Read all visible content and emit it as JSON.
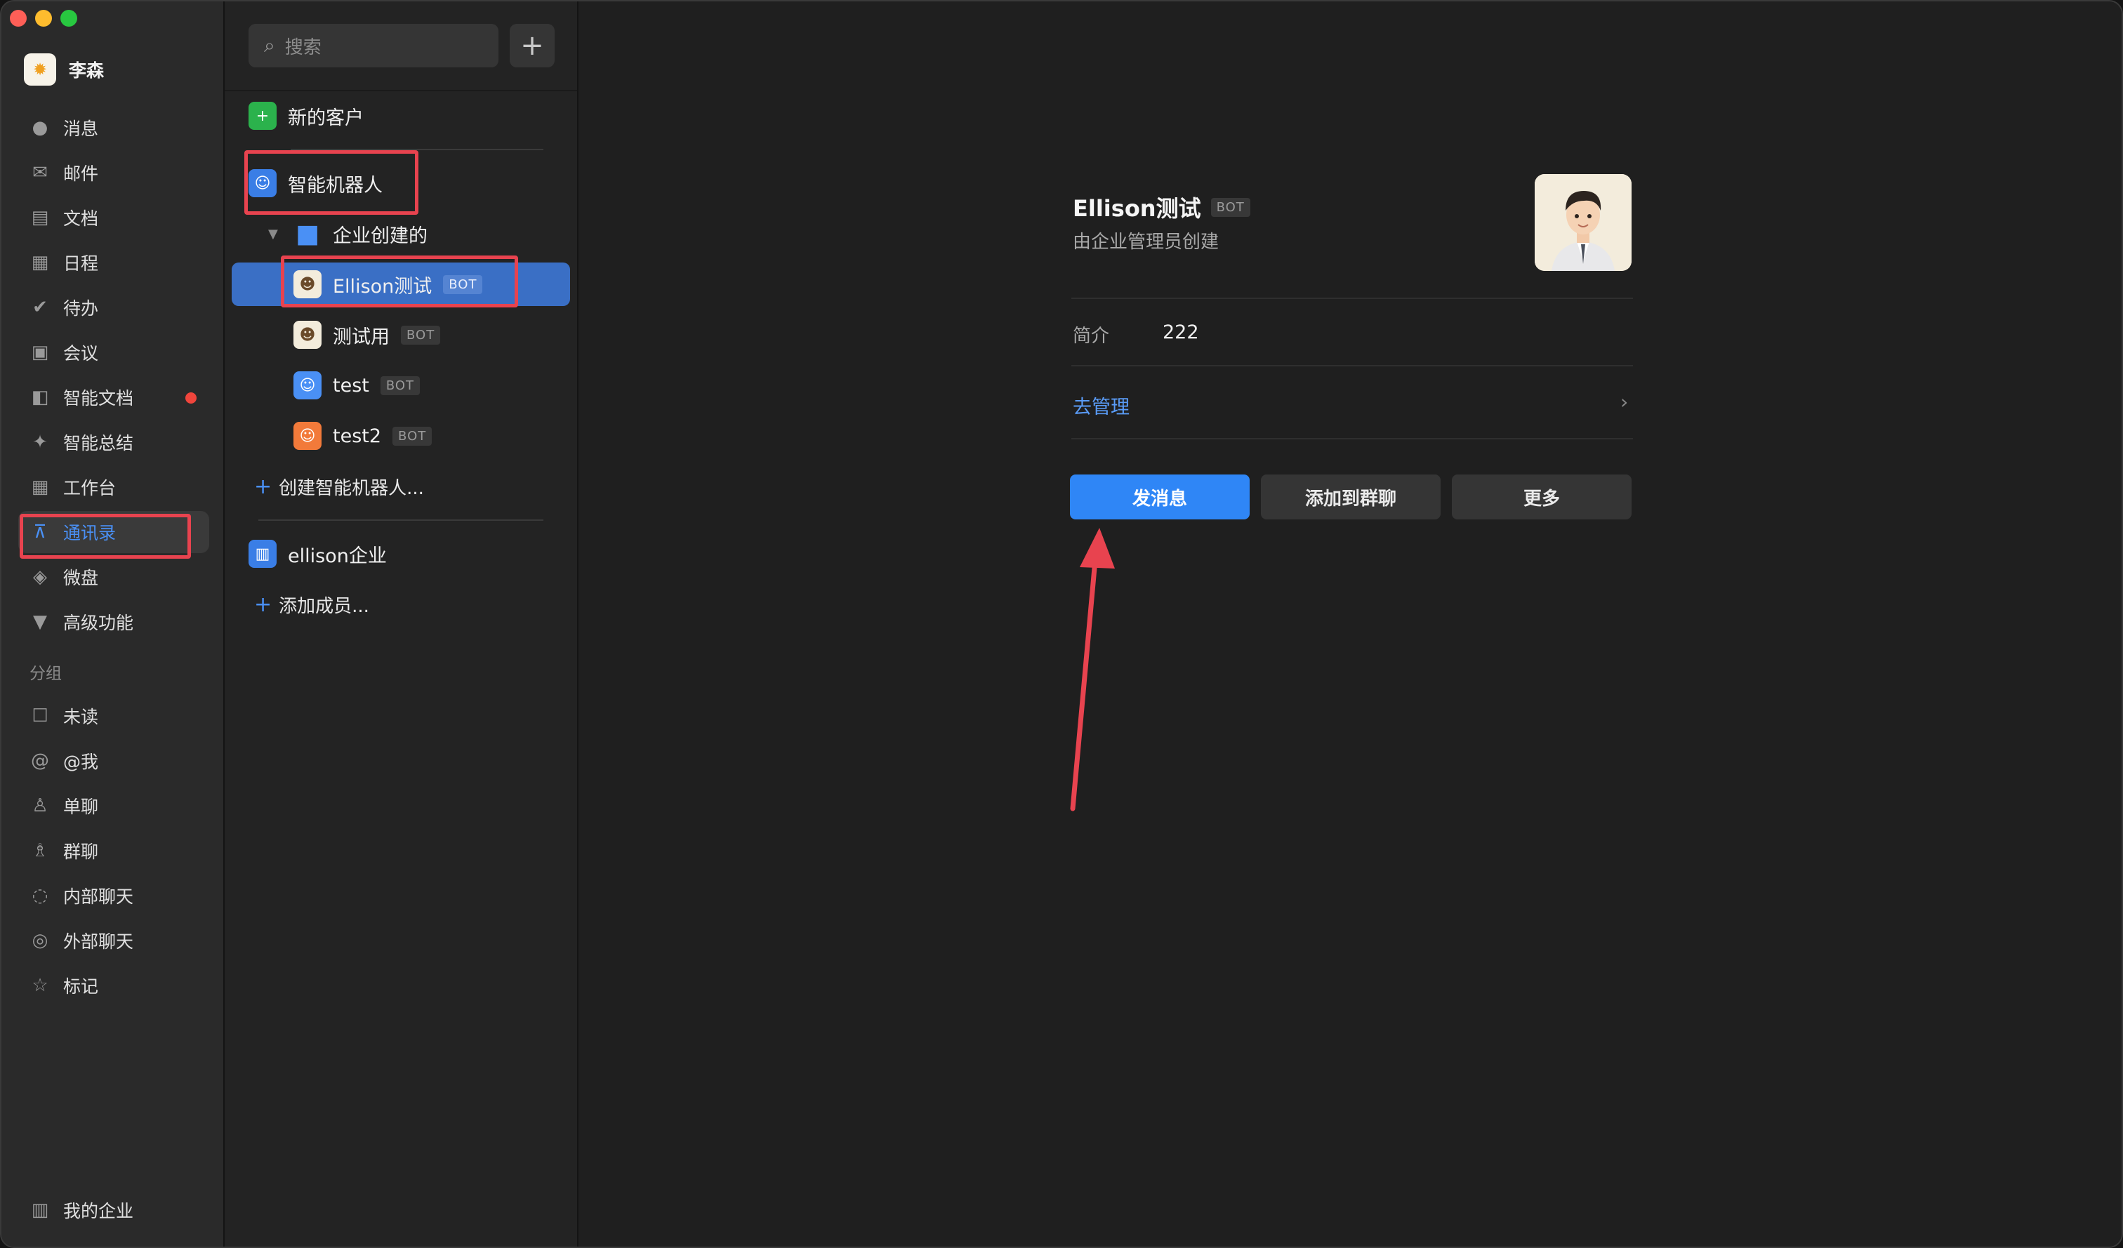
{
  "user": {
    "name": "李森"
  },
  "nav": {
    "items": [
      {
        "label": "消息",
        "icon": "chat-bubble-icon"
      },
      {
        "label": "邮件",
        "icon": "mail-icon"
      },
      {
        "label": "文档",
        "icon": "document-icon"
      },
      {
        "label": "日程",
        "icon": "calendar-icon"
      },
      {
        "label": "待办",
        "icon": "check-circle-icon"
      },
      {
        "label": "会议",
        "icon": "meeting-icon"
      },
      {
        "label": "智能文档",
        "icon": "smart-doc-icon"
      },
      {
        "label": "智能总结",
        "icon": "sparkle-icon"
      },
      {
        "label": "工作台",
        "icon": "grid-icon"
      },
      {
        "label": "通讯录",
        "icon": "org-chart-icon"
      },
      {
        "label": "微盘",
        "icon": "drive-icon"
      },
      {
        "label": "高级功能",
        "icon": "premium-icon"
      }
    ],
    "group_title": "分组",
    "groups": [
      {
        "label": "未读",
        "icon": "unread-icon"
      },
      {
        "label": "@我",
        "icon": "at-icon"
      },
      {
        "label": "单聊",
        "icon": "person-icon"
      },
      {
        "label": "群聊",
        "icon": "people-icon"
      },
      {
        "label": "内部聊天",
        "icon": "internal-chat-icon"
      },
      {
        "label": "外部聊天",
        "icon": "external-chat-icon"
      },
      {
        "label": "标记",
        "icon": "star-icon"
      }
    ],
    "footer": "我的企业"
  },
  "contacts": {
    "search_placeholder": "搜索",
    "new_customer": "新的客户",
    "robots_section": "智能机器人",
    "folder": "企业创建的",
    "bots": [
      {
        "name": "Ellison测试",
        "badge": "BOT"
      },
      {
        "name": "测试用",
        "badge": "BOT"
      },
      {
        "name": "test",
        "badge": "BOT"
      },
      {
        "name": "test2",
        "badge": "BOT"
      }
    ],
    "create_bot": "创建智能机器人...",
    "company": "ellison企业",
    "add_member": "添加成员..."
  },
  "detail": {
    "name": "Ellison测试",
    "badge": "BOT",
    "subtitle": "由企业管理员创建",
    "intro_label": "简介",
    "intro_value": "222",
    "manage_link": "去管理",
    "buttons": {
      "send": "发消息",
      "add_to_group": "添加到群聊",
      "more": "更多"
    }
  },
  "colors": {
    "accent": "#2f86f6",
    "selected_row": "#3a6fc5",
    "annotation": "#e8434f",
    "badge_dot": "#f0453c"
  }
}
